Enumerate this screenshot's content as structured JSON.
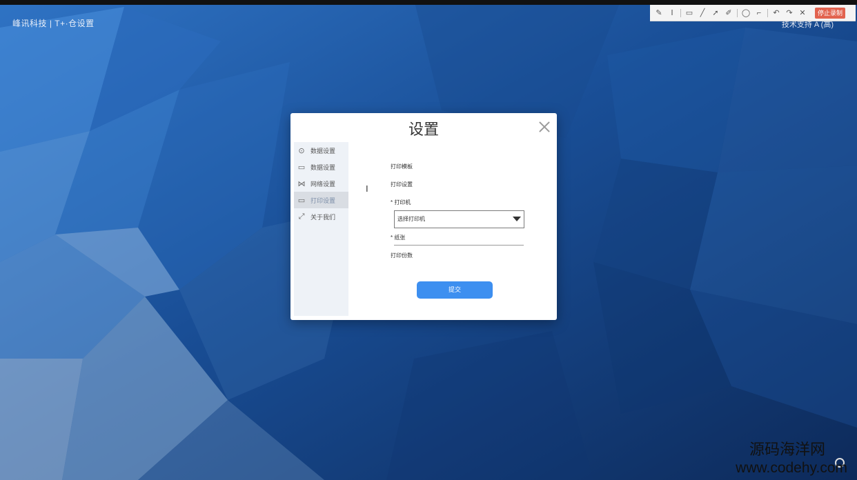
{
  "app": {
    "title": "峰讯科技 | T+·仓设置",
    "user_info": "技术支持 A (高)"
  },
  "toolbar": {
    "tools": [
      "pen-icon",
      "text-icon",
      "rect-icon",
      "line-icon",
      "arrow-icon",
      "marker-icon",
      "circle-icon",
      "crop-icon",
      "undo-icon",
      "redo-icon",
      "close-icon"
    ],
    "tool_glyphs": [
      "✎",
      "Ⅰ",
      "▭",
      "╱",
      "➚",
      "✐",
      "◯",
      "⌐",
      "↶",
      "↷",
      "✕"
    ],
    "record_label": "停止录制"
  },
  "dialog": {
    "title": "设置",
    "side_items": [
      {
        "icon": "⊙",
        "label": "数据设置",
        "active": false
      },
      {
        "icon": "▭",
        "label": "数据设置",
        "active": false
      },
      {
        "icon": "⋈",
        "label": "网络设置",
        "active": false
      },
      {
        "icon": "▭",
        "label": "打印设置",
        "active": true
      },
      {
        "icon": "⤢",
        "label": "关于我们",
        "active": false
      }
    ],
    "form": {
      "label_1": "打印模板",
      "label_2": "打印设置",
      "label_3": "* 打印机",
      "select_value": "选择打印机",
      "label_4": "* 纸张",
      "label_5": "打印份数"
    },
    "submit_label": "提交"
  },
  "watermark": {
    "cn": "源码海洋网",
    "url": "www.codehy.com"
  }
}
